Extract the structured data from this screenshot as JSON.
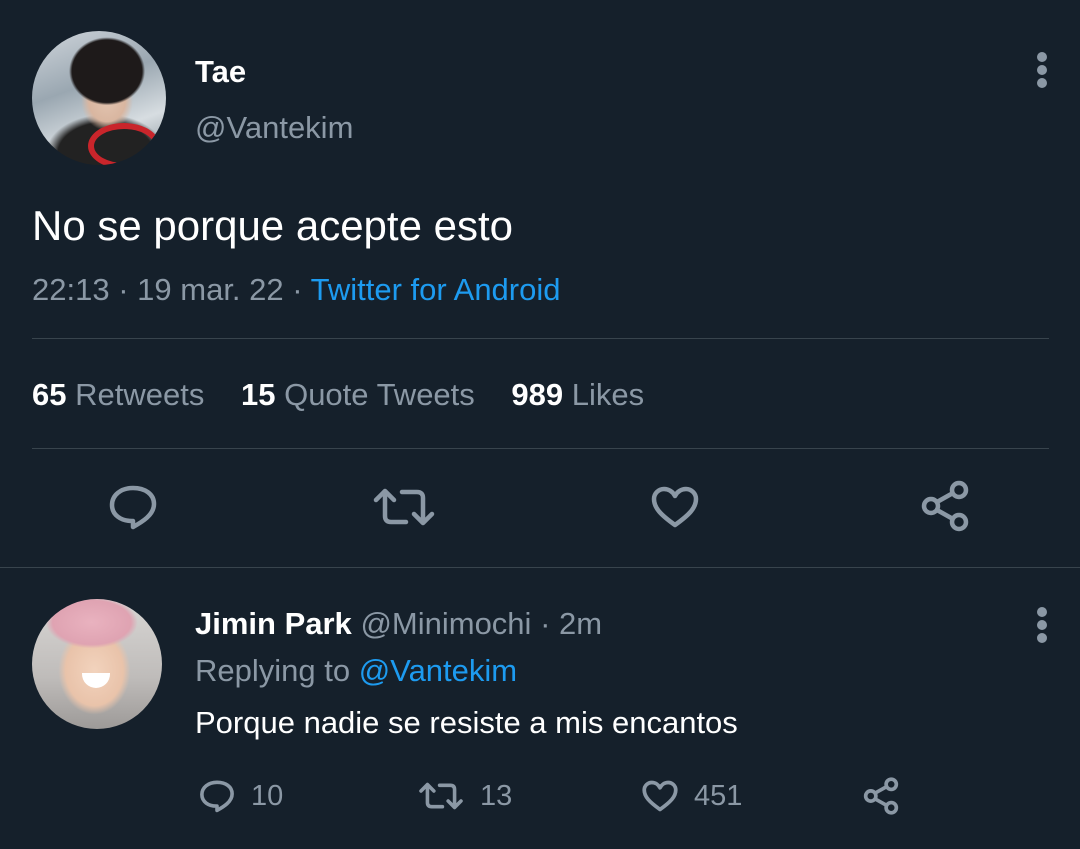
{
  "tweet": {
    "author_name": "Tae",
    "author_handle": "@Vantekim",
    "text": "No se porque acepte esto",
    "time": "22:13",
    "date": "19 mar. 22",
    "separator": "·",
    "client": "Twitter for Android",
    "stats": {
      "retweets_count": "65",
      "retweets_label": "Retweets",
      "quotes_count": "15",
      "quotes_label": "Quote Tweets",
      "likes_count": "989",
      "likes_label": "Likes"
    },
    "actions": [
      "reply-icon",
      "retweet-icon",
      "like-icon",
      "share-icon"
    ]
  },
  "reply": {
    "author_name": "Jimin Park",
    "author_handle": "@Minimochi",
    "separator": "·",
    "age": "2m",
    "replying_label": "Replying to",
    "replying_to": "@Vantekim",
    "text": "Porque nadie se resiste a mis encantos",
    "reply_count": "10",
    "retweet_count": "13",
    "like_count": "451"
  },
  "colors": {
    "background": "#15202b",
    "text": "#ffffff",
    "muted": "#8b98a5",
    "accent": "#1d9bf0",
    "divider": "#38444d"
  }
}
